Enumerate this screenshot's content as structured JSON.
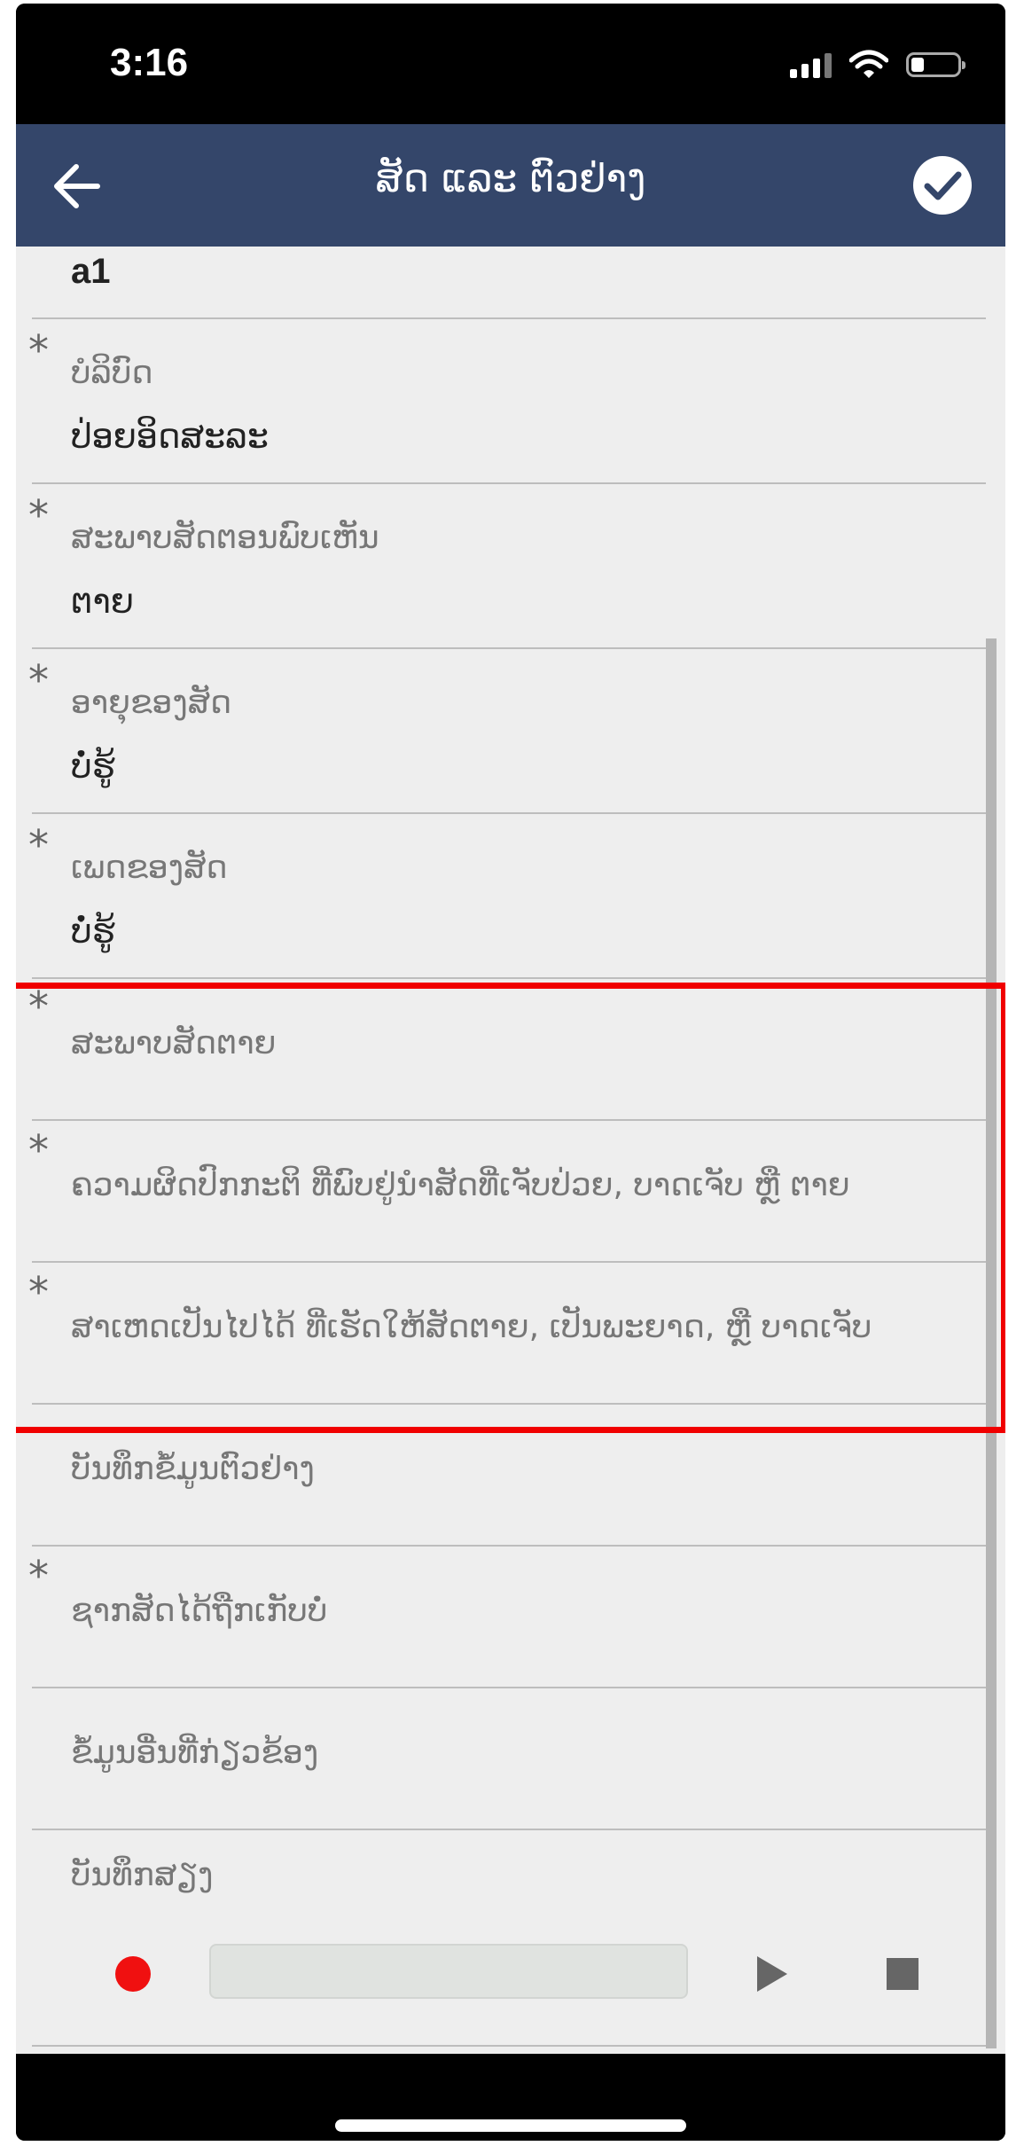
{
  "status_bar": {
    "time": "3:16"
  },
  "header": {
    "title": "ສັດ ແລະ ຕົວຢ່າງ"
  },
  "form": {
    "top_value": "a1",
    "fields": [
      {
        "label": "ບໍລິບົດ",
        "value": "ປ່ອຍອິດສະລະ"
      },
      {
        "label": "ສະພາບສັດຕອນພົບເຫັນ",
        "value": "ຕາຍ"
      },
      {
        "label": "ອາຍຸຂອງສັດ",
        "value": "ບໍ່ຮູ້"
      },
      {
        "label": "ເພດຂອງສັດ",
        "value": "ບໍ່ຮູ້"
      },
      {
        "label": "ສະພາບສັດຕາຍ"
      },
      {
        "label": "ຄວາມຜິດປົກກະຕິ ທີ່ພົບຢູ່ນຳສັດທີ່ເຈັບປ່ວຍ, ບາດເຈັບ ຫຼື ຕາຍ"
      },
      {
        "label": "ສາເຫດເປັນໄປໄດ້ ທີ່ເຮັດໃຫ້ສັດຕາຍ, ເປັນພະຍາດ, ຫຼື ບາດເຈັບ"
      },
      {
        "label": "ບັນທຶກຂໍ້ມູນຕົວຢ່າງ"
      },
      {
        "label": "ຊາກສັດໄດ້ຖືກເກັບບໍ່"
      },
      {
        "label": "ຂໍ້ມູນອື່ນທີ່ກ່ຽວຂ້ອງ"
      },
      {
        "label": "ບັນທຶກສຽງ"
      }
    ]
  },
  "colors": {
    "header_bg": "#34466a",
    "content_bg": "#eeeeee",
    "highlight": "#f00000",
    "record": "#f01010"
  },
  "icons": [
    "back-arrow-icon",
    "check-circle-icon",
    "signal-icon",
    "wifi-icon",
    "battery-icon",
    "play-icon",
    "stop-icon"
  ]
}
